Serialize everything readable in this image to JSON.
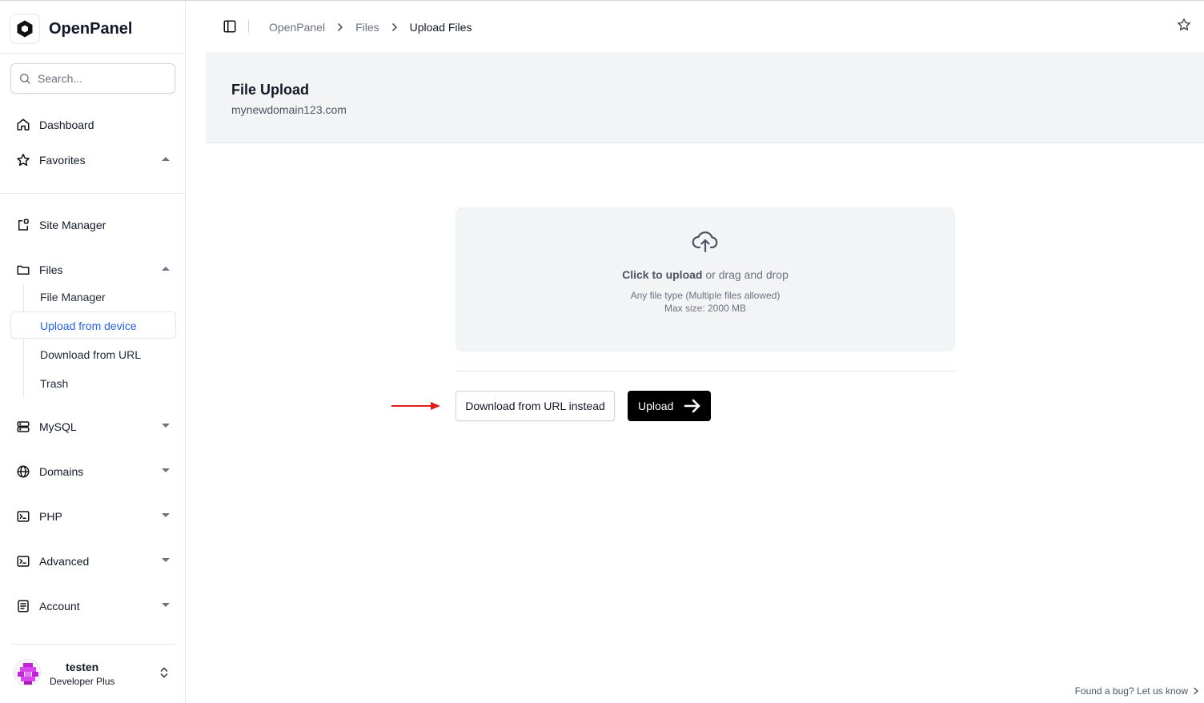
{
  "app": {
    "name": "OpenPanel"
  },
  "search": {
    "placeholder": "Search..."
  },
  "sidebar": {
    "dashboard": "Dashboard",
    "favorites": "Favorites",
    "site_manager": "Site Manager",
    "files": "Files",
    "files_sub": [
      "File Manager",
      "Upload from device",
      "Download from URL",
      "Trash"
    ],
    "mysql": "MySQL",
    "domains": "Domains",
    "php": "PHP",
    "advanced": "Advanced",
    "account": "Account"
  },
  "user": {
    "name": "testen",
    "plan": "Developer Plus"
  },
  "breadcrumb": [
    "OpenPanel",
    "Files",
    "Upload Files"
  ],
  "page": {
    "title": "File Upload",
    "subtitle": "mynewdomain123.com"
  },
  "dropzone": {
    "click_text": "Click to upload",
    "drag_text": " or drag and drop",
    "types": "Any file type (Multiple files allowed)",
    "max": "Max size: 2000 MB"
  },
  "buttons": {
    "download_url": "Download from URL instead",
    "upload": "Upload"
  },
  "footer": {
    "bug": "Found a bug? Let us know"
  },
  "colors": {
    "active_link": "#2563eb",
    "annotation_arrow": "#e11d1d",
    "primary_button": "#000000"
  }
}
